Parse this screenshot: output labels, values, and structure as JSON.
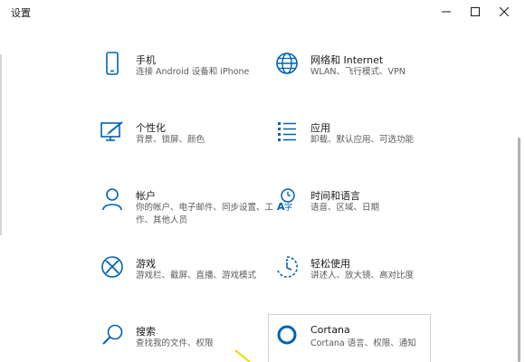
{
  "window": {
    "title": "设置"
  },
  "colors": {
    "accent": "#0063b1",
    "text": "#1a1a1a",
    "subtext": "#5a5a5a"
  },
  "tiles": [
    {
      "icon": "phone-icon",
      "name": "手机",
      "desc": "连接 Android 设备和 iPhone"
    },
    {
      "icon": "globe-icon",
      "name": "网络和 Internet",
      "desc": "WLAN、飞行模式、VPN"
    },
    {
      "icon": "personalization-icon",
      "name": "个性化",
      "desc": "背景、锁屏、颜色"
    },
    {
      "icon": "apps-icon",
      "name": "应用",
      "desc": "卸载、默认应用、可选功能"
    },
    {
      "icon": "account-icon",
      "name": "帐户",
      "desc": "你的帐户、电子邮件、同步设置、工作、其他人员"
    },
    {
      "icon": "time-language-icon",
      "name": "时间和语言",
      "desc": "语音、区域、日期"
    },
    {
      "icon": "xbox-icon",
      "name": "游戏",
      "desc": "游戏栏、截屏、直播、游戏模式"
    },
    {
      "icon": "ease-of-access-icon",
      "name": "轻松使用",
      "desc": "讲述人、放大镜、高对比度"
    },
    {
      "icon": "search-icon",
      "name": "搜索",
      "desc": "查找我的文件、权限"
    },
    {
      "icon": "cortana-icon",
      "name": "Cortana",
      "desc": "Cortana 语言、权限、通知"
    }
  ]
}
